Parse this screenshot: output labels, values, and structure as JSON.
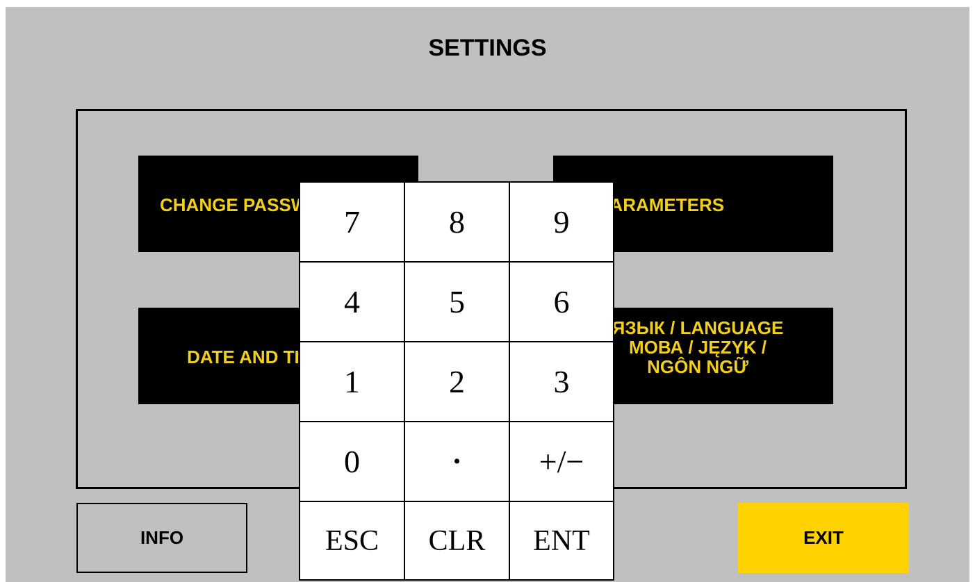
{
  "title": "SETTINGS",
  "buttons": {
    "change_password": "CHANGE PASSWORD",
    "parameters": "PARAMETERS",
    "date_and_time": "DATE AND TIME",
    "language_lines": [
      "ЯЗЫК / LANGUAGE",
      "МОВА / JĘZYK /",
      "NGÔN NGỮ"
    ],
    "info": "INFO",
    "exit": "EXIT"
  },
  "keypad": {
    "keys": [
      "7",
      "8",
      "9",
      "4",
      "5",
      "6",
      "1",
      "2",
      "3",
      "0",
      "•",
      "+/−",
      "ESC",
      "CLR",
      "ENT"
    ]
  },
  "colors": {
    "background": "#c0c0c0",
    "button_bg": "#000000",
    "button_text": "#f2cf1d",
    "exit_bg": "#ffd200",
    "keypad_bg": "#ffffff"
  }
}
